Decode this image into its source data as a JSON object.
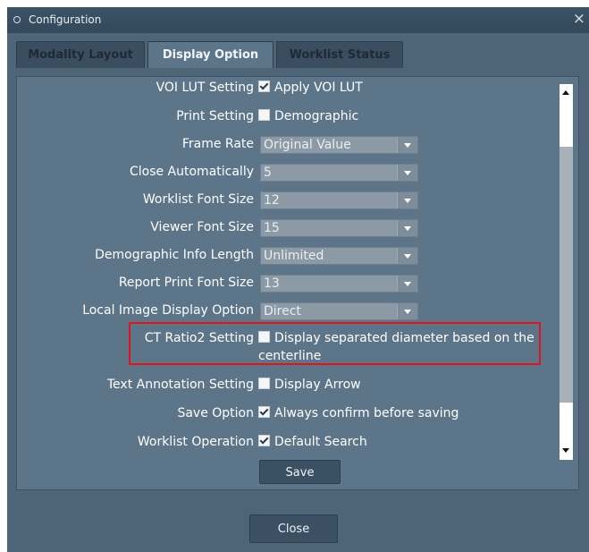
{
  "window": {
    "title": "Configuration",
    "close_glyph": "×"
  },
  "tabs": [
    "Modality Layout",
    "Display Option",
    "Worklist Status"
  ],
  "settings": {
    "voi_lut": {
      "label": "VOI LUT Setting",
      "value": "Apply VOI LUT",
      "checked": true
    },
    "print": {
      "label": "Print Setting",
      "value": "Demographic",
      "checked": false
    },
    "frame_rate": {
      "label": "Frame Rate",
      "value": "Original Value"
    },
    "close_auto": {
      "label": "Close Automatically",
      "value": "5"
    },
    "worklist_font": {
      "label": "Worklist Font Size",
      "value": "12"
    },
    "viewer_font": {
      "label": "Viewer Font Size",
      "value": "15"
    },
    "demo_info": {
      "label": "Demographic Info Length",
      "value": "Unlimited"
    },
    "report_font": {
      "label": "Report Print Font Size",
      "value": "13"
    },
    "local_image": {
      "label": "Local Image Display Option",
      "value": "Direct"
    },
    "ct_ratio": {
      "label": "CT Ratio2 Setting",
      "value_line1": "Display separated diameter based on the",
      "value_line2": "centerline",
      "checked": false
    },
    "text_annot": {
      "label": "Text Annotation Setting",
      "value": "Display Arrow",
      "checked": false
    },
    "save_option": {
      "label": "Save Option",
      "value": "Always confirm before saving",
      "checked": true
    },
    "worklist_op": {
      "label": "Worklist Operation",
      "value": "Default Search",
      "checked": true
    }
  },
  "buttons": {
    "save": "Save",
    "close": "Close"
  },
  "colors": {
    "highlight": "#e0151b",
    "panel": "#5d7588",
    "frame": "#4e6477"
  }
}
